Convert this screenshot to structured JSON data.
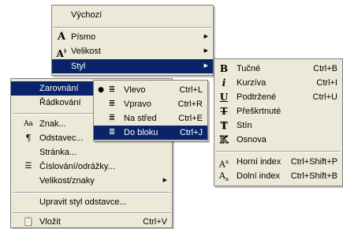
{
  "format_menu": {
    "default": "Výchozí",
    "font": "Písmo",
    "size": "Velikost",
    "style": "Styl"
  },
  "paragraph_menu": {
    "alignment": "Zarovnání",
    "line_spacing": "Řádkování",
    "character": "Znak...",
    "paragraph": "Odstavec...",
    "page": "Stránka...",
    "numbering": "Číslování/odrážky...",
    "size_case": "Velikost/znaky",
    "edit_paragraph_style": "Upravit styl odstavce...",
    "paste": "Vložit",
    "paste_shortcut": "Ctrl+V"
  },
  "alignment_menu": [
    {
      "label": "Vlevo",
      "shortcut": "Ctrl+L",
      "checked": true
    },
    {
      "label": "Vpravo",
      "shortcut": "Ctrl+R",
      "checked": false
    },
    {
      "label": "Na střed",
      "shortcut": "Ctrl+E",
      "checked": false
    },
    {
      "label": "Do bloku",
      "shortcut": "Ctrl+J",
      "checked": false
    }
  ],
  "style_menu": [
    {
      "label": "Tučné",
      "shortcut": "Ctrl+B",
      "icon": "bold-icon"
    },
    {
      "label": "Kurzíva",
      "shortcut": "Ctrl+I",
      "icon": "italic-icon"
    },
    {
      "label": "Podtržené",
      "shortcut": "Ctrl+U",
      "icon": "underline-icon"
    },
    {
      "label": "Přeškrtnuté",
      "shortcut": "",
      "icon": "strikethrough-icon"
    },
    {
      "label": "Stín",
      "shortcut": "",
      "icon": "shadow-icon"
    },
    {
      "label": "Osnova",
      "shortcut": "",
      "icon": "outline-icon"
    },
    {
      "label": "Horní index",
      "shortcut": "Ctrl+Shift+P",
      "icon": "superscript-icon"
    },
    {
      "label": "Dolní index",
      "shortcut": "Ctrl+Shift+B",
      "icon": "subscript-icon"
    }
  ],
  "colors": {
    "menu_bg": "#ece9d8",
    "highlight": "#0a246a"
  }
}
